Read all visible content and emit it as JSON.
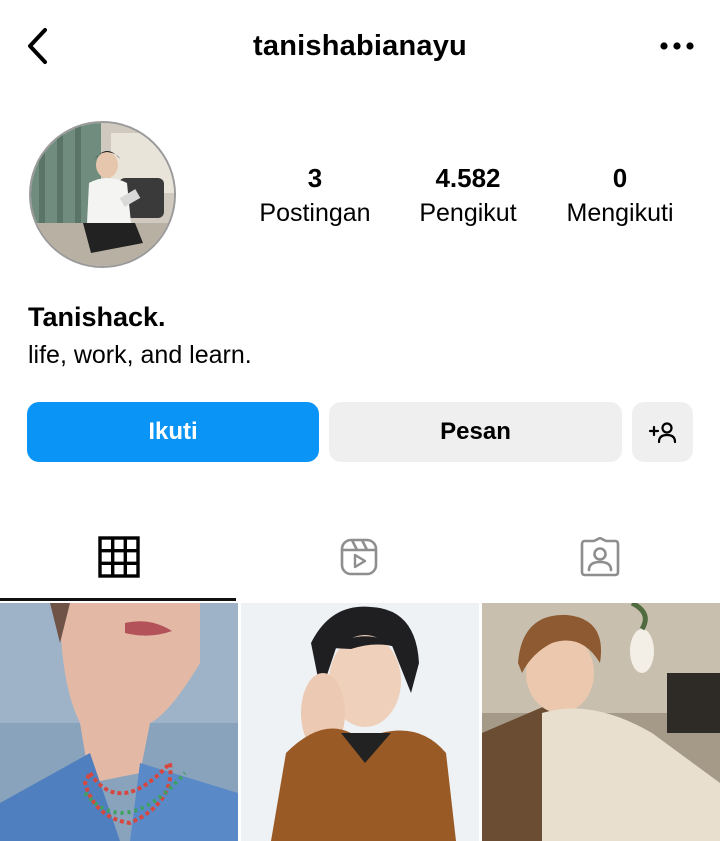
{
  "header": {
    "username": "tanishabianayu",
    "back_icon": "chevron-left-icon",
    "more_icon": "more-horizontal-icon"
  },
  "profile": {
    "avatar_icon": "profile-photo",
    "stats": {
      "posts": {
        "value": "3",
        "label": "Postingan"
      },
      "followers": {
        "value": "4.582",
        "label": "Pengikut"
      },
      "following": {
        "value": "0",
        "label": "Mengikuti"
      }
    },
    "display_name": "Tanishack.",
    "bio": "life, work, and learn."
  },
  "actions": {
    "follow_label": "Ikuti",
    "message_label": "Pesan",
    "suggest_icon": "add-person-icon",
    "accent_color": "#0a95f6",
    "secondary_color": "#efefef"
  },
  "tabs": [
    {
      "name": "posts-grid",
      "icon": "grid-icon",
      "active": true
    },
    {
      "name": "reels",
      "icon": "reels-icon",
      "active": false
    },
    {
      "name": "tagged",
      "icon": "tagged-person-icon",
      "active": false
    }
  ],
  "posts": [
    {
      "icon": "photo-thumbnail",
      "description_visible": false
    },
    {
      "icon": "photo-thumbnail",
      "description_visible": false
    },
    {
      "icon": "photo-thumbnail",
      "description_visible": false
    }
  ]
}
